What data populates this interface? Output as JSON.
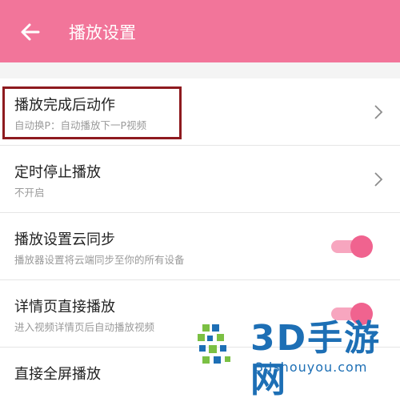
{
  "header": {
    "title": "播放设置",
    "back_icon": "arrow-left-icon"
  },
  "colors": {
    "accent": "#f2759a",
    "toggle_on": "#f0638f",
    "highlight": "#8e1a1f",
    "watermark": "#1d6fb5"
  },
  "settings": [
    {
      "title": "播放完成后动作",
      "subtitle": "自动换P：自动播放下一P视频",
      "control": "chevron"
    },
    {
      "title": "定时停止播放",
      "subtitle": "不开启",
      "control": "chevron"
    },
    {
      "title": "播放设置云同步",
      "subtitle": "播放器设置将云端同步至你的所有设备",
      "control": "toggle",
      "on": true
    },
    {
      "title": "详情页直接播放",
      "subtitle": "进入视频详情页后自动播放视频",
      "control": "toggle",
      "on": true
    },
    {
      "title": "直接全屏播放",
      "subtitle": "",
      "control": "none"
    }
  ],
  "watermark": {
    "text": "3D手游网",
    "url": "3dshouyou.com"
  }
}
